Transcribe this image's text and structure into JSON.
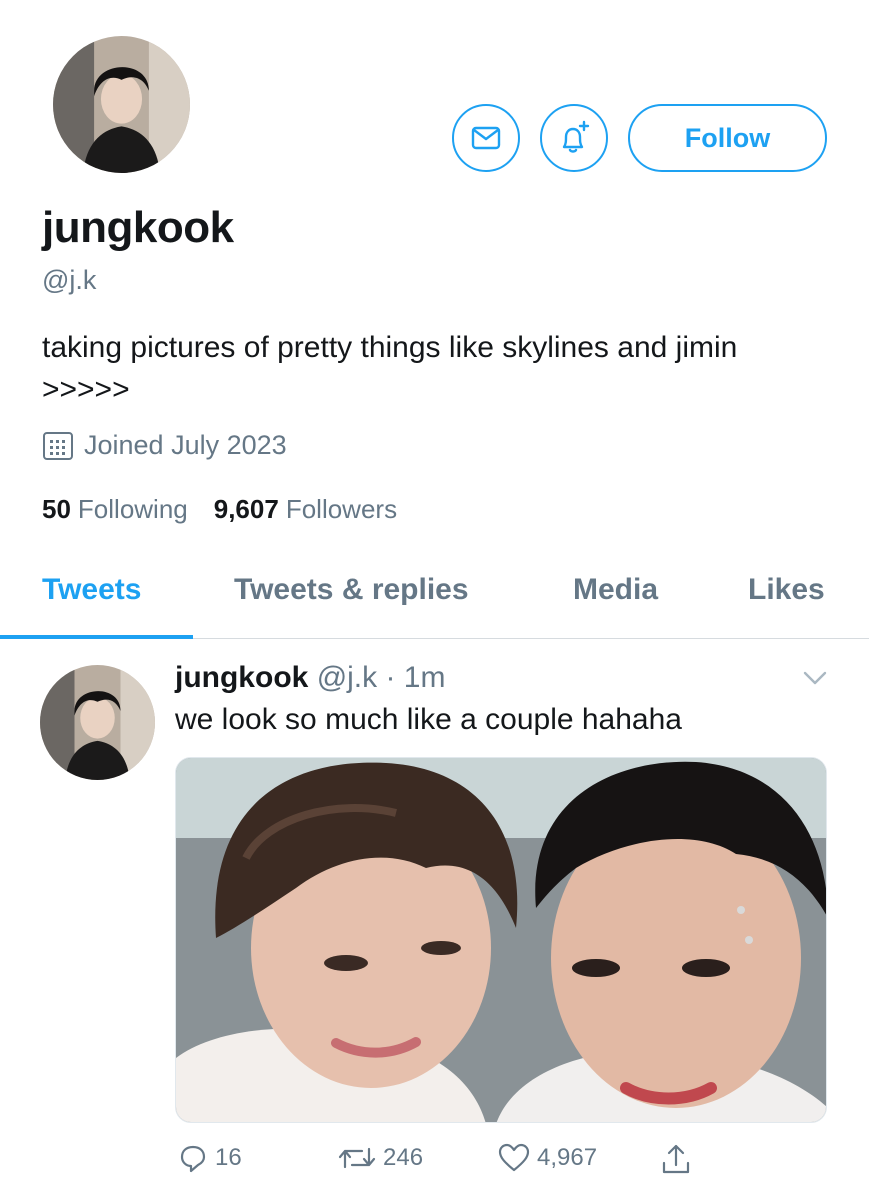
{
  "profile": {
    "display_name": "jungkook",
    "handle": "@j.k",
    "bio": "taking pictures of pretty things like skylines and jimin >>>>>",
    "joined": "Joined July 2023",
    "following_count": "50",
    "following_label": "Following",
    "followers_count": "9,607",
    "followers_label": "Followers"
  },
  "header_actions": {
    "message_icon": "mail-icon",
    "notify_icon": "bell-plus-icon",
    "follow_label": "Follow"
  },
  "tabs": [
    {
      "label": "Tweets",
      "active": true
    },
    {
      "label": "Tweets & replies",
      "active": false
    },
    {
      "label": "Media",
      "active": false
    },
    {
      "label": "Likes",
      "active": false
    }
  ],
  "tweet": {
    "name": "jungkook",
    "meta": "@j.k · 1m",
    "text": "we look so much like a couple hahaha",
    "reply_count": "16",
    "retweet_count": "246",
    "like_count": "4,967"
  },
  "colors": {
    "accent": "#1da1f2",
    "secondary_text": "#657786",
    "primary_text": "#14171a",
    "divider": "#d6dbdf"
  }
}
